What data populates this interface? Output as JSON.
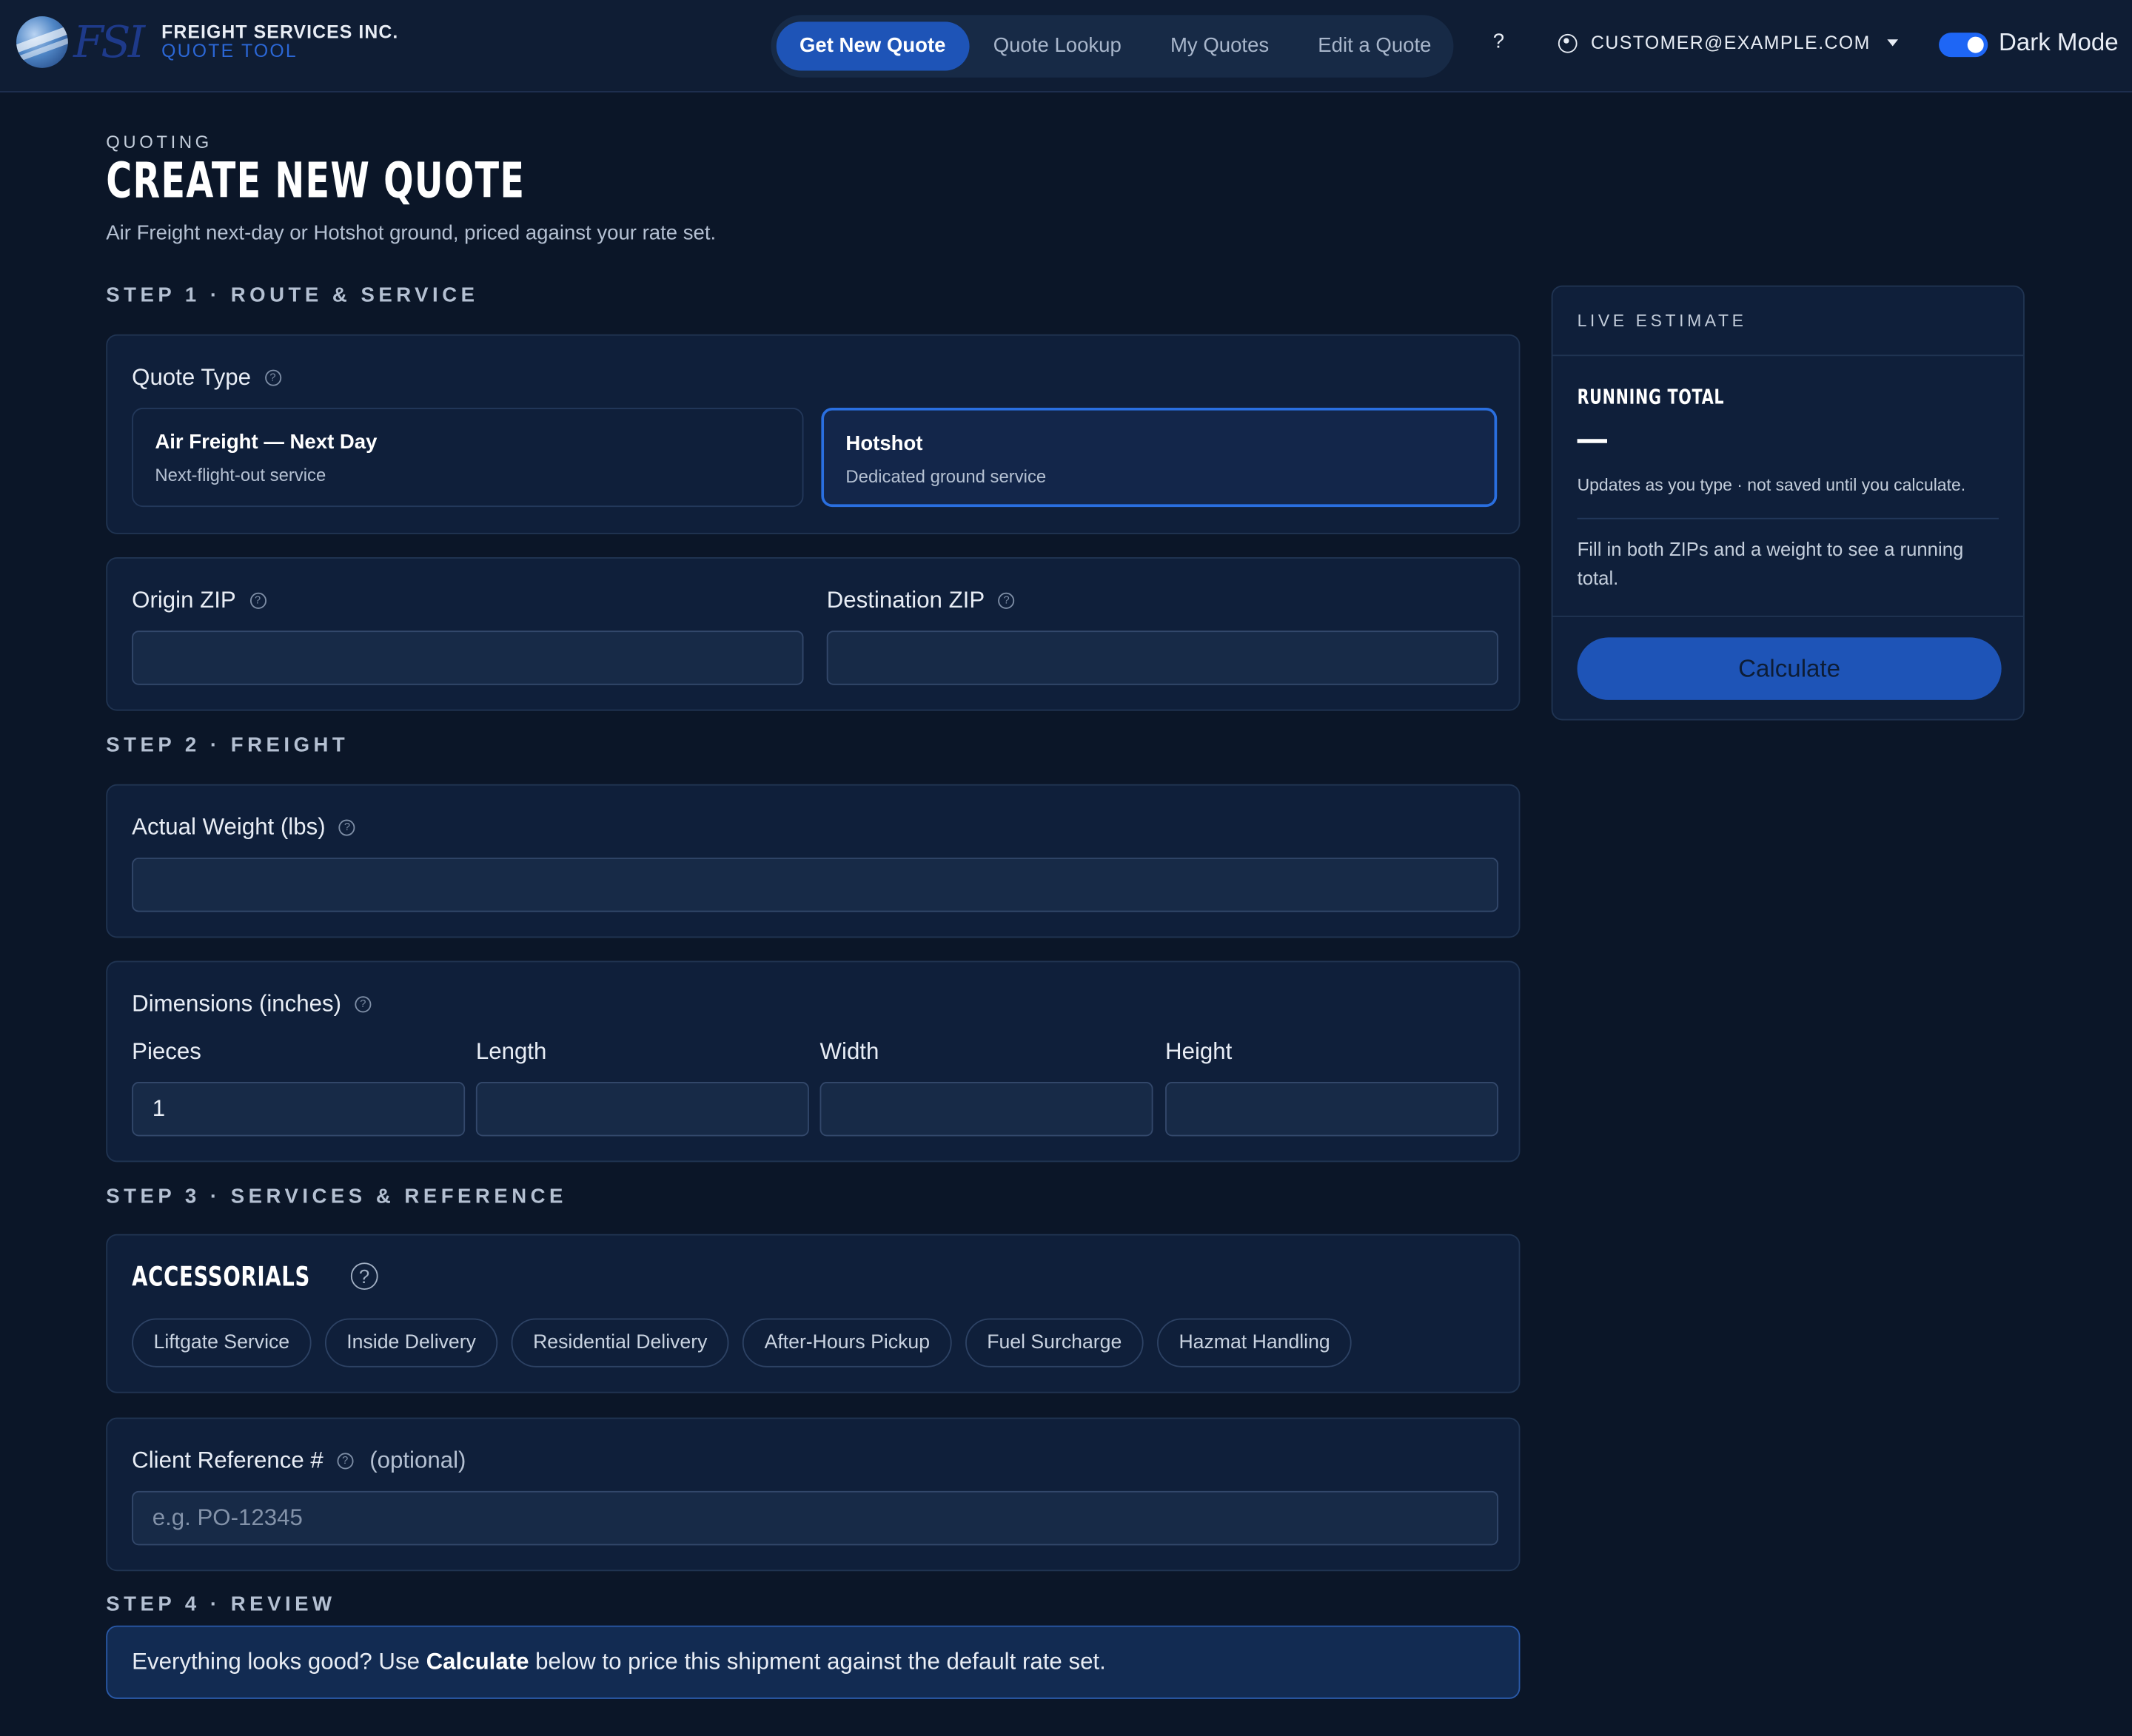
{
  "brand": {
    "name": "FREIGHT SERVICES INC.",
    "sub": "QUOTE TOOL",
    "mark": "FSI"
  },
  "nav": {
    "links": [
      "Get New Quote",
      "Quote Lookup",
      "My Quotes",
      "Edit a Quote"
    ],
    "help": "?",
    "user": "CUSTOMER@EXAMPLE.COM",
    "dark_mode_label": "Dark Mode",
    "dark_mode_on": true
  },
  "header": {
    "eyebrow": "QUOTING",
    "title": "CREATE NEW QUOTE",
    "subtitle": "Air Freight next-day or Hotshot ground, priced against your rate set."
  },
  "steps": {
    "s1": "STEP 1 · ROUTE & SERVICE",
    "s2": "STEP 2 · FREIGHT",
    "s3": "STEP 3 · SERVICES & REFERENCE",
    "s4": "STEP 4 · REVIEW"
  },
  "quote_type": {
    "label": "Quote Type",
    "options": [
      {
        "title": "Air Freight — Next Day",
        "sub": "Next-flight-out service",
        "selected": false
      },
      {
        "title": "Hotshot",
        "sub": "Dedicated ground service",
        "selected": true
      }
    ]
  },
  "route": {
    "origin_label": "Origin ZIP",
    "origin_value": "",
    "dest_label": "Destination ZIP",
    "dest_value": ""
  },
  "freight": {
    "weight_label": "Actual Weight (lbs)",
    "weight_value": "",
    "dims_label": "Dimensions (inches)",
    "pieces_label": "Pieces",
    "pieces_value": "1",
    "length_label": "Length",
    "length_value": "",
    "width_label": "Width",
    "width_value": "",
    "height_label": "Height",
    "height_value": ""
  },
  "accessorials": {
    "title": "ACCESSORIALS",
    "items": [
      "Liftgate Service",
      "Inside Delivery",
      "Residential Delivery",
      "After-Hours Pickup",
      "Fuel Surcharge",
      "Hazmat Handling"
    ]
  },
  "reference": {
    "label": "Client Reference #",
    "optional": "(optional)",
    "placeholder": "e.g. PO-12345",
    "value": ""
  },
  "review": {
    "before": "Everything looks good? Use ",
    "bold": "Calculate",
    "after": " below to price this shipment against the default rate set."
  },
  "estimate": {
    "head": "LIVE ESTIMATE",
    "running_total": "RUNNING TOTAL",
    "total_value": "—",
    "updates_note": "Updates as you type · not saved until you calculate.",
    "fill_note": "Fill in both ZIPs and a weight to see a running total.",
    "calculate": "Calculate"
  },
  "icons": {
    "help": "question-circle-icon",
    "user": "user-circle-icon",
    "caret": "caret-down-icon",
    "logo": "globe-logo-icon"
  },
  "colors": {
    "background": "#0b1628",
    "accent": "#1e54b7",
    "card": "#0f1f3a"
  }
}
